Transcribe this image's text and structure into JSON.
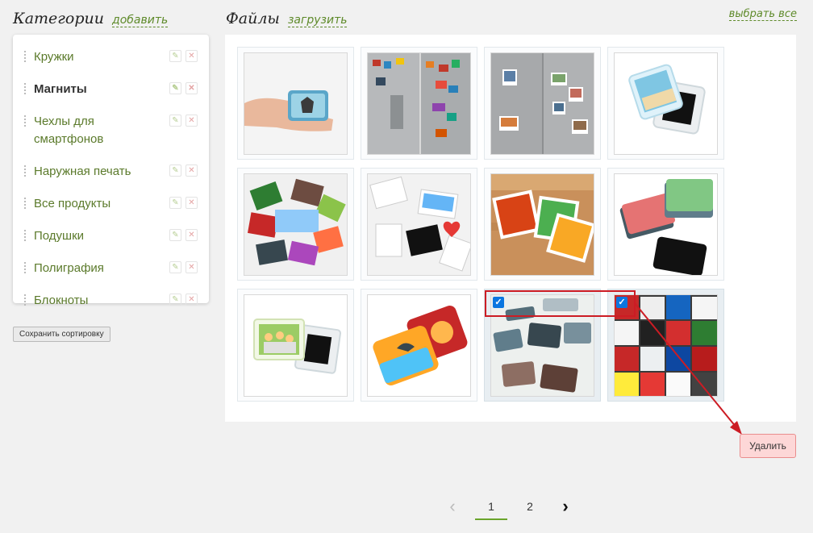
{
  "categories": {
    "title": "Категории",
    "add_link": "добавить",
    "items": [
      {
        "label": "Кружки",
        "active": false
      },
      {
        "label": "Магниты",
        "active": true
      },
      {
        "label": "Чехлы для смартфонов",
        "active": false
      },
      {
        "label": "Наружная печать",
        "active": false
      },
      {
        "label": "Все продукты",
        "active": false
      },
      {
        "label": "Подушки",
        "active": false
      },
      {
        "label": "Полиграфия",
        "active": false
      },
      {
        "label": "Блокноты",
        "active": false
      }
    ],
    "edit_icon": "pencil-icon",
    "delete_icon": "cross-icon",
    "save_sort_label": "Сохранить сортировку"
  },
  "files": {
    "title": "Файлы",
    "upload_link": "загрузить",
    "select_all_link": "выбрать все",
    "delete_label": "Удалить",
    "thumbnails": [
      {
        "subject": "hand-holding-magnet",
        "checked": false
      },
      {
        "subject": "fridge-with-magnets",
        "checked": false
      },
      {
        "subject": "fridge-with-photo-magnets",
        "checked": false
      },
      {
        "subject": "acrylic-magnet-frame",
        "checked": false
      },
      {
        "subject": "scattered-photo-magnets",
        "checked": false
      },
      {
        "subject": "cyprus-magnets",
        "checked": false
      },
      {
        "subject": "christmas-photo-magnets",
        "checked": false
      },
      {
        "subject": "stacked-photo-magnets",
        "checked": false
      },
      {
        "subject": "family-photo-magnet-frame",
        "checked": false
      },
      {
        "subject": "dolphin-and-pizza-magnets",
        "checked": false
      },
      {
        "subject": "flat-lay-magnets",
        "checked": true
      },
      {
        "subject": "new-york-magnets",
        "checked": true
      }
    ]
  },
  "pagination": {
    "prev": "‹",
    "pages": [
      "1",
      "2"
    ],
    "current": "1",
    "next": "›"
  },
  "colors": {
    "link_green": "#5e8a2a",
    "delete_bg": "#fdd7d7",
    "annotation_red": "#cc1c24",
    "checkbox_blue": "#0b76e0"
  }
}
